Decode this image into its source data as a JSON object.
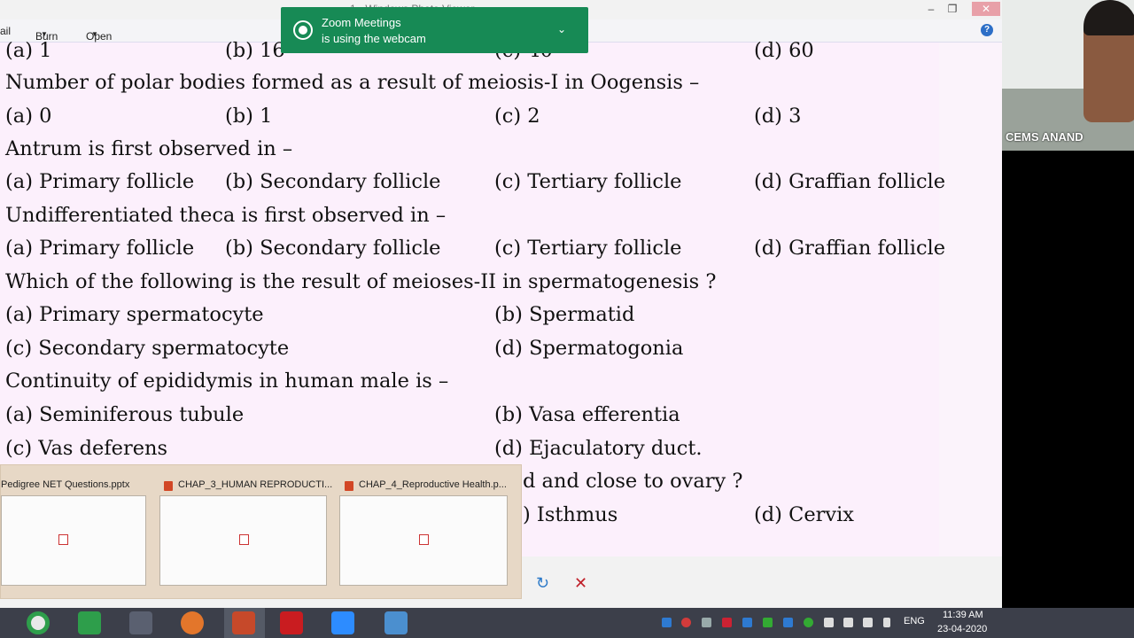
{
  "window": {
    "title": "1 - Windows Photo Viewer",
    "menu": {
      "email": "ail",
      "burn": "Burn",
      "open": "Open"
    },
    "close_glyph": "✕"
  },
  "document_lines": [
    {
      "id": "opt-a-prev",
      "text": "(a) 1"
    },
    {
      "id": "opt-b-prev",
      "text": "(b) 16"
    },
    {
      "id": "opt-c-prev",
      "text": "(c) 40"
    },
    {
      "id": "opt-d-prev",
      "text": "(d) 60"
    },
    {
      "id": "q-polar",
      "text": "Number of polar bodies formed as a result of meiosis-I in Oogensis –"
    },
    {
      "id": "q-polar-a",
      "text": "(a) 0"
    },
    {
      "id": "q-polar-b",
      "text": "(b) 1"
    },
    {
      "id": "q-polar-c",
      "text": "(c) 2"
    },
    {
      "id": "q-polar-d",
      "text": "(d) 3"
    },
    {
      "id": "q-antrum",
      "text": "Antrum is first observed in –"
    },
    {
      "id": "q-antrum-a",
      "text": "(a) Primary follicle"
    },
    {
      "id": "q-antrum-b",
      "text": "(b) Secondary follicle"
    },
    {
      "id": "q-antrum-c",
      "text": "(c) Tertiary follicle"
    },
    {
      "id": "q-antrum-d",
      "text": "(d) Graffian follicle"
    },
    {
      "id": "q-theca",
      "text": "Undifferentiated theca is first observed in –"
    },
    {
      "id": "q-theca-a",
      "text": "(a) Primary follicle"
    },
    {
      "id": "q-theca-b",
      "text": "(b) Secondary follicle"
    },
    {
      "id": "q-theca-c",
      "text": "(c) Tertiary follicle"
    },
    {
      "id": "q-theca-d",
      "text": "(d) Graffian follicle"
    },
    {
      "id": "q-meiosis",
      "text": "Which of the following is the result of meioses-II in spermatogenesis ?"
    },
    {
      "id": "q-meiosis-a",
      "text": "(a) Primary spermatocyte"
    },
    {
      "id": "q-meiosis-b",
      "text": "(b) Spermatid"
    },
    {
      "id": "q-meiosis-c",
      "text": "(c) Secondary spermatocyte"
    },
    {
      "id": "q-meiosis-d",
      "text": "(d) Spermatogonia"
    },
    {
      "id": "q-epid",
      "text": "Continuity of epididymis in human male is –"
    },
    {
      "id": "q-epid-a",
      "text": "(a) Seminiferous tubule"
    },
    {
      "id": "q-epid-b",
      "text": "(b) Vasa efferentia"
    },
    {
      "id": "q-epid-c",
      "text": "(c) Vas deferens"
    },
    {
      "id": "q-epid-d",
      "text": "(d) Ejaculatory duct."
    },
    {
      "id": "q-ovary-tail",
      "text": "d and close to ovary ?"
    },
    {
      "id": "q-ovary-c",
      "text": ") Isthmus"
    },
    {
      "id": "q-ovary-d",
      "text": "(d) Cervix"
    }
  ],
  "toast": {
    "line1": "Zoom Meetings",
    "line2": "is using the webcam",
    "chevron": "⌄"
  },
  "thumbnails": [
    {
      "title": "Pedigree NET Questions.pptx"
    },
    {
      "title": "CHAP_3_HUMAN REPRODUCTI..."
    },
    {
      "title": "CHAP_4_Reproductive Health.p..."
    }
  ],
  "viewer_controls": {
    "rotate": "↻",
    "delete": "✕"
  },
  "webcam": {
    "label": "CEMS ANAND"
  },
  "taskbar": {
    "language": "ENG",
    "time": "11:39 AM",
    "date": "23-04-2020"
  },
  "colors": {
    "toast": "#178a55",
    "taskbar": "#3c3f4a",
    "page": "#fcf0fc"
  }
}
